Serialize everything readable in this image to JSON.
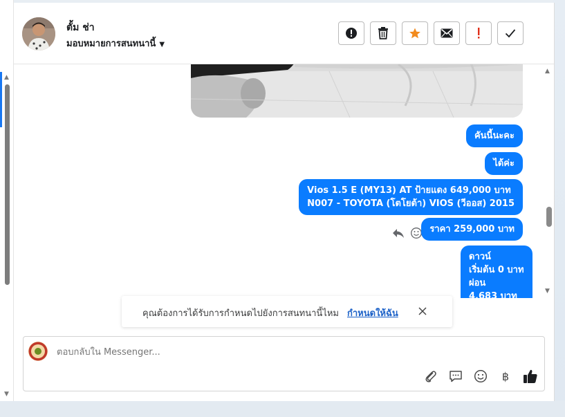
{
  "header": {
    "user_name": "ตั้ม ช่า",
    "assign_label": "มอบหมายการสนทนานี้",
    "actions": [
      {
        "icon": "alert-circle-icon",
        "label": "mark-spam"
      },
      {
        "icon": "trash-icon",
        "label": "delete"
      },
      {
        "icon": "star-icon",
        "label": "star"
      },
      {
        "icon": "envelope-icon",
        "label": "mark-unread"
      },
      {
        "icon": "exclamation-icon",
        "label": "follow-up"
      },
      {
        "icon": "check-icon",
        "label": "done"
      }
    ]
  },
  "messages": [
    {
      "text": "คันนี้นะคะ"
    },
    {
      "text": "ได้ค่ะ"
    },
    {
      "lines": [
        "Vios 1.5 E (MY13) AT ป้ายแดง 649,000 บาท",
        "N007 - TOYOTA (โตโยต้า) VIOS (วีออส) 2015"
      ]
    },
    {
      "text": "ราคา 259,000 บาท"
    },
    {
      "lines": [
        "ดาวน์",
        "เริ่มต้น 0 บาท",
        "ผ่อน",
        "4,683 บาท"
      ]
    }
  ],
  "notice": {
    "text": "คุณต้องการได้รับการกำหนดไปยังการสนทนานี้ไหม",
    "link": "กำหนดให้ฉัน"
  },
  "composer": {
    "placeholder": "ตอบกลับใน Messenger...",
    "tools": [
      "paperclip-icon",
      "saved-reply-icon",
      "emoji-icon",
      "baht-icon",
      "thumbs-up-icon"
    ],
    "baht_symbol": "฿"
  },
  "colors": {
    "bubble": "#0a7cff",
    "star": "#f28b1e",
    "flag": "#e0311b",
    "link": "#1d62c8"
  }
}
